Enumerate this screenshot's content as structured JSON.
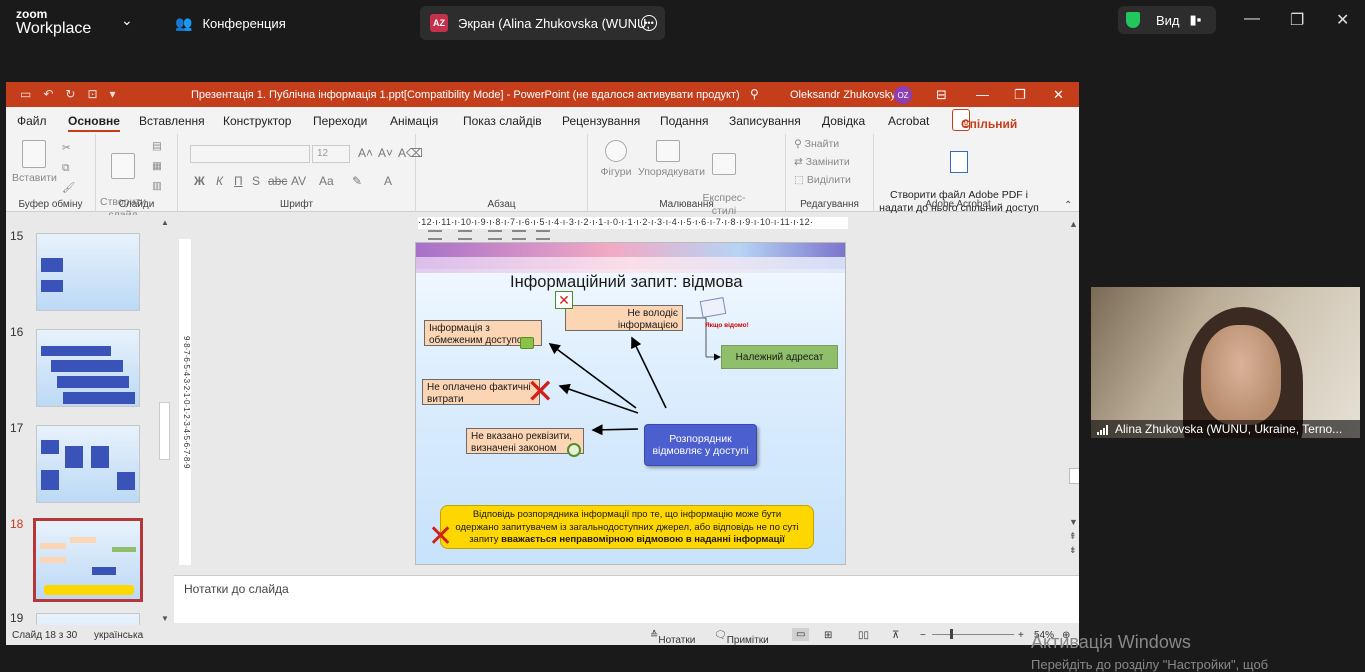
{
  "zoom": {
    "brand_top": "zoom",
    "brand_bottom": "Workplace",
    "tab_conference": "Конференция",
    "tab_screen_initials": "AZ",
    "tab_screen": "Экран (Alina Zhukovska (WUNU,",
    "view_label": "Вид",
    "activate_title": "Активація Windows",
    "activate_sub": "Перейдіть до розділу \"Настройки\", щоб"
  },
  "ppt": {
    "title": "Презентація 1. Публічна інформація 1.ppt[Compatibility Mode]  -  PowerPoint (не вдалося активувати продукт)",
    "user": "Oleksandr Zhukovsky",
    "user_initials": "OZ",
    "menu": [
      "Файл",
      "Основне",
      "Вставлення",
      "Конструктор",
      "Переходи",
      "Анімація",
      "Показ слайдів",
      "Рецензування",
      "Подання",
      "Записування",
      "Довідка",
      "Acrobat"
    ],
    "share": "Спільний доступ",
    "ribbon": {
      "paste": "Вставити",
      "create_slide": "Створити\nслайд",
      "font_size": "12",
      "shapes": "Фігури",
      "arrange": "Упорядкувати",
      "express": "Експрес-\nстилі",
      "find": "Знайти",
      "replace": "Замінити",
      "select": "Виділити",
      "acrobat_btn": "Створити файл Adobe PDF і\nнадати до нього спільний доступ",
      "groups": [
        "Буфер обміну",
        "Слайди",
        "Шрифт",
        "Абзац",
        "Малювання",
        "Редагування",
        "Adobe Acrobat"
      ]
    },
    "ruler_h": "·12·ı·11·ı·10·ı·9·ı·8·ı·7·ı·6·ı·5·ı·4·ı·3·ı·2·ı·1·ı·0·ı·1·ı·2·ı·3·ı·4·ı·5·ı·6·ı·7·ı·8·ı·9·ı·10·ı·11·ı·12·",
    "ruler_v": "9·8·7·6·5·4·3·2·1·0·1·2·3·4·5·6·7·8·9",
    "thumb_numbers": [
      "15",
      "16",
      "17",
      "18",
      "19"
    ],
    "slide": {
      "title": "Інформаційний запит: відмова",
      "box_restricted": "Інформація з обмеженим доступом",
      "box_not_own": "Не володіє інформацією",
      "box_not_paid": "Не оплачено фактичні витрати",
      "box_no_details": "Не вказано реквізити, визначені законом",
      "email_note": "Якщо відомо!",
      "box_addressee": "Належний адресат",
      "box_manager": "Розпорядник відмовляє у доступі",
      "footer_text": "Відповідь розпорядника інформації про те, що інформацію може бути одержано запитувачем із загальнодоступних джерел, або відповідь не по суті запиту",
      "footer_bold": "вважається неправомірною відмовою в наданні інформації"
    },
    "notes": "Нотатки до слайда",
    "status": {
      "slide": "Слайд 18 з 30",
      "lang": "українська",
      "notes": "Нотатки",
      "comments": "Примітки",
      "zoom": "54%"
    }
  },
  "webcam": {
    "label": "Alina Zhukovska (WUNU, Ukraine, Terno..."
  }
}
